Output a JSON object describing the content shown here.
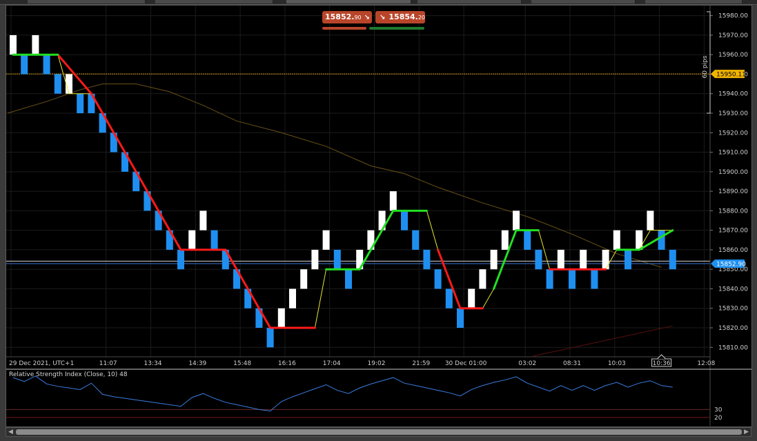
{
  "quotes": {
    "sell_price_main": "15852.",
    "sell_price_sub": "90",
    "buy_price_main": "15854.",
    "buy_price_sub": "20",
    "sell_arrow": "↘",
    "buy_arrow": "↘",
    "sell_color": "#b8452a",
    "buy_color": "#b8452a"
  },
  "price_chart": {
    "type": "renko",
    "y_ticks": [
      "15980.00",
      "15970.00",
      "15960.00",
      "15950.00",
      "15940.00",
      "15930.00",
      "15920.00",
      "15910.00",
      "15900.00",
      "15890.00",
      "15880.00",
      "15870.00",
      "15860.00",
      "15850.00",
      "15840.00",
      "15830.00",
      "15820.00",
      "15810.00"
    ],
    "y_tick_values": [
      15980,
      15970,
      15960,
      15950,
      15940,
      15930,
      15920,
      15910,
      15900,
      15890,
      15880,
      15870,
      15860,
      15850,
      15840,
      15830,
      15820,
      15810
    ],
    "ylim": [
      15805.5,
      15982
    ],
    "x_labels": [
      "29 Dec 2021, UTC+1",
      "11:07",
      "13:34",
      "14:39",
      "15:48",
      "16:16",
      "17:04",
      "19:02",
      "21:59",
      "30 Dec 01:00",
      "03:02",
      "08:31",
      "10:03",
      "10:36",
      "12:08"
    ],
    "x_label_slots": [
      0,
      8.5,
      12.5,
      16.5,
      20.5,
      24.5,
      28.5,
      32.5,
      36.5,
      40.5,
      46,
      50,
      54,
      58,
      62
    ],
    "brick_size": 10,
    "bricks": [
      {
        "t": 0,
        "o": 15960,
        "c": 15970
      },
      {
        "t": 1,
        "o": 15960,
        "c": 15950
      },
      {
        "t": 2,
        "o": 15960,
        "c": 15970
      },
      {
        "t": 3,
        "o": 15960,
        "c": 15950
      },
      {
        "t": 4,
        "o": 15950,
        "c": 15940
      },
      {
        "t": 5,
        "o": 15940,
        "c": 15950
      },
      {
        "t": 6,
        "o": 15940,
        "c": 15930
      },
      {
        "t": 7,
        "o": 15940,
        "c": 15930
      },
      {
        "t": 8,
        "o": 15930,
        "c": 15920
      },
      {
        "t": 9,
        "o": 15920,
        "c": 15910
      },
      {
        "t": 10,
        "o": 15910,
        "c": 15900
      },
      {
        "t": 11,
        "o": 15900,
        "c": 15890
      },
      {
        "t": 12,
        "o": 15890,
        "c": 15880
      },
      {
        "t": 13,
        "o": 15880,
        "c": 15870
      },
      {
        "t": 14,
        "o": 15870,
        "c": 15860
      },
      {
        "t": 15,
        "o": 15860,
        "c": 15850
      },
      {
        "t": 16,
        "o": 15860,
        "c": 15870
      },
      {
        "t": 17,
        "o": 15870,
        "c": 15880
      },
      {
        "t": 18,
        "o": 15870,
        "c": 15860
      },
      {
        "t": 19,
        "o": 15860,
        "c": 15850
      },
      {
        "t": 20,
        "o": 15850,
        "c": 15840
      },
      {
        "t": 21,
        "o": 15840,
        "c": 15830
      },
      {
        "t": 22,
        "o": 15830,
        "c": 15820
      },
      {
        "t": 23,
        "o": 15820,
        "c": 15810
      },
      {
        "t": 24,
        "o": 15820,
        "c": 15830
      },
      {
        "t": 25,
        "o": 15830,
        "c": 15840
      },
      {
        "t": 26,
        "o": 15840,
        "c": 15850
      },
      {
        "t": 27,
        "o": 15850,
        "c": 15860
      },
      {
        "t": 28,
        "o": 15860,
        "c": 15870
      },
      {
        "t": 29,
        "o": 15860,
        "c": 15850
      },
      {
        "t": 30,
        "o": 15850,
        "c": 15840
      },
      {
        "t": 31,
        "o": 15850,
        "c": 15860
      },
      {
        "t": 32,
        "o": 15860,
        "c": 15870
      },
      {
        "t": 33,
        "o": 15870,
        "c": 15880
      },
      {
        "t": 34,
        "o": 15880,
        "c": 15890
      },
      {
        "t": 35,
        "o": 15880,
        "c": 15870
      },
      {
        "t": 36,
        "o": 15870,
        "c": 15860
      },
      {
        "t": 37,
        "o": 15860,
        "c": 15850
      },
      {
        "t": 38,
        "o": 15850,
        "c": 15840
      },
      {
        "t": 39,
        "o": 15840,
        "c": 15830
      },
      {
        "t": 40,
        "o": 15830,
        "c": 15820
      },
      {
        "t": 41,
        "o": 15830,
        "c": 15840
      },
      {
        "t": 42,
        "o": 15840,
        "c": 15850
      },
      {
        "t": 43,
        "o": 15850,
        "c": 15860
      },
      {
        "t": 44,
        "o": 15860,
        "c": 15870
      },
      {
        "t": 45,
        "o": 15870,
        "c": 15880
      },
      {
        "t": 46,
        "o": 15870,
        "c": 15860
      },
      {
        "t": 47,
        "o": 15860,
        "c": 15850
      },
      {
        "t": 48,
        "o": 15850,
        "c": 15840
      },
      {
        "t": 49,
        "o": 15850,
        "c": 15860
      },
      {
        "t": 50,
        "o": 15850,
        "c": 15840
      },
      {
        "t": 51,
        "o": 15850,
        "c": 15860
      },
      {
        "t": 52,
        "o": 15850,
        "c": 15840
      },
      {
        "t": 53,
        "o": 15850,
        "c": 15860
      },
      {
        "t": 54,
        "o": 15860,
        "c": 15870
      },
      {
        "t": 55,
        "o": 15860,
        "c": 15850
      },
      {
        "t": 56,
        "o": 15860,
        "c": 15870
      },
      {
        "t": 57,
        "o": 15870,
        "c": 15880
      },
      {
        "t": 58,
        "o": 15870,
        "c": 15860
      },
      {
        "t": 59,
        "o": 15860,
        "c": 15850
      }
    ],
    "trend_line": [
      {
        "x": 0,
        "y": 15960
      },
      {
        "x": 4,
        "y": 15960
      },
      {
        "x": 5,
        "y": 15940
      },
      {
        "x": 7,
        "y": 15940
      },
      {
        "x": 15,
        "y": 15860
      },
      {
        "x": 19,
        "y": 15860
      },
      {
        "x": 23,
        "y": 15820
      },
      {
        "x": 27,
        "y": 15820
      },
      {
        "x": 28,
        "y": 15850
      },
      {
        "x": 31,
        "y": 15850
      },
      {
        "x": 34,
        "y": 15880
      },
      {
        "x": 37,
        "y": 15880
      },
      {
        "x": 38,
        "y": 15860
      },
      {
        "x": 40,
        "y": 15830
      },
      {
        "x": 42,
        "y": 15830
      },
      {
        "x": 43,
        "y": 15840
      },
      {
        "x": 45,
        "y": 15870
      },
      {
        "x": 47,
        "y": 15870
      },
      {
        "x": 48,
        "y": 15850
      },
      {
        "x": 53,
        "y": 15850
      },
      {
        "x": 54,
        "y": 15860
      },
      {
        "x": 56,
        "y": 15860
      },
      {
        "x": 57,
        "y": 15870
      },
      {
        "x": 59,
        "y": 15870
      }
    ],
    "trend_red_segments": [
      [
        4,
        7
      ],
      [
        7,
        15
      ],
      [
        15,
        19
      ],
      [
        19,
        23
      ],
      [
        23,
        27
      ],
      [
        38,
        40
      ],
      [
        40,
        42
      ],
      [
        48,
        53
      ]
    ],
    "trend_green_segments": [
      [
        0,
        4
      ],
      [
        28,
        31
      ],
      [
        31,
        34
      ],
      [
        34,
        37
      ],
      [
        43,
        45
      ],
      [
        45,
        47
      ],
      [
        54,
        56
      ],
      [
        56,
        59
      ]
    ],
    "moving_average": [
      {
        "x": -0.5,
        "y": 15930
      },
      {
        "x": 3,
        "y": 15936
      },
      {
        "x": 6,
        "y": 15942
      },
      {
        "x": 8,
        "y": 15945
      },
      {
        "x": 11,
        "y": 15945
      },
      {
        "x": 14,
        "y": 15941
      },
      {
        "x": 17,
        "y": 15934
      },
      {
        "x": 20,
        "y": 15926
      },
      {
        "x": 24,
        "y": 15920
      },
      {
        "x": 28,
        "y": 15913
      },
      {
        "x": 32,
        "y": 15903
      },
      {
        "x": 35,
        "y": 15899
      },
      {
        "x": 38,
        "y": 15892
      },
      {
        "x": 42,
        "y": 15884
      },
      {
        "x": 46,
        "y": 15877
      },
      {
        "x": 50,
        "y": 15868
      },
      {
        "x": 54,
        "y": 15858
      },
      {
        "x": 58,
        "y": 15851
      }
    ],
    "red_trend_ray": {
      "from": {
        "x": 46.5,
        "y": 15805.5
      },
      "to": {
        "x": 59,
        "y": 15821
      }
    },
    "bid_line": 15852.9,
    "ask_line": 15854.2,
    "bid_label": "15852.90",
    "target_line": 15950.11,
    "target_label": "15950.11",
    "range_label": "60 pips",
    "range": [
      15930,
      15982
    ],
    "colors": {
      "up_brick": "#ffffff",
      "down_brick": "#1e8ff0",
      "trend_up": "#22e022",
      "trend_down": "#ff1a1a",
      "trend_flip": "#e8e830",
      "moving_average": "#6b5316",
      "target_line": "#d49b1a",
      "bid_label_bg": "#1e8ff0",
      "target_label_bg": "#f0b400"
    }
  },
  "rsi": {
    "title": "Relative Strength Index (Close, 10) 48",
    "levels": [
      "30",
      "20"
    ],
    "level_values": [
      30,
      20
    ],
    "ylim": [
      13,
      77
    ],
    "line_color": "#3a7de0",
    "points": [
      {
        "x": 0,
        "y": 70
      },
      {
        "x": 1,
        "y": 65
      },
      {
        "x": 2,
        "y": 72
      },
      {
        "x": 3,
        "y": 62
      },
      {
        "x": 4,
        "y": 59
      },
      {
        "x": 5,
        "y": 57
      },
      {
        "x": 6,
        "y": 55
      },
      {
        "x": 7,
        "y": 63
      },
      {
        "x": 8,
        "y": 49
      },
      {
        "x": 9,
        "y": 46
      },
      {
        "x": 10,
        "y": 44
      },
      {
        "x": 11,
        "y": 42
      },
      {
        "x": 12,
        "y": 40
      },
      {
        "x": 13,
        "y": 38
      },
      {
        "x": 14,
        "y": 36
      },
      {
        "x": 15,
        "y": 34
      },
      {
        "x": 16,
        "y": 45
      },
      {
        "x": 17,
        "y": 50
      },
      {
        "x": 18,
        "y": 44
      },
      {
        "x": 19,
        "y": 39
      },
      {
        "x": 20,
        "y": 36
      },
      {
        "x": 21,
        "y": 33
      },
      {
        "x": 22,
        "y": 30
      },
      {
        "x": 23,
        "y": 28
      },
      {
        "x": 24,
        "y": 40
      },
      {
        "x": 25,
        "y": 46
      },
      {
        "x": 26,
        "y": 51
      },
      {
        "x": 27,
        "y": 56
      },
      {
        "x": 28,
        "y": 61
      },
      {
        "x": 29,
        "y": 54
      },
      {
        "x": 30,
        "y": 50
      },
      {
        "x": 31,
        "y": 57
      },
      {
        "x": 32,
        "y": 62
      },
      {
        "x": 33,
        "y": 66
      },
      {
        "x": 34,
        "y": 70
      },
      {
        "x": 35,
        "y": 63
      },
      {
        "x": 36,
        "y": 60
      },
      {
        "x": 37,
        "y": 57
      },
      {
        "x": 38,
        "y": 54
      },
      {
        "x": 39,
        "y": 51
      },
      {
        "x": 40,
        "y": 47
      },
      {
        "x": 41,
        "y": 55
      },
      {
        "x": 42,
        "y": 60
      },
      {
        "x": 43,
        "y": 64
      },
      {
        "x": 44,
        "y": 67
      },
      {
        "x": 45,
        "y": 71
      },
      {
        "x": 46,
        "y": 63
      },
      {
        "x": 47,
        "y": 58
      },
      {
        "x": 48,
        "y": 53
      },
      {
        "x": 49,
        "y": 60
      },
      {
        "x": 50,
        "y": 54
      },
      {
        "x": 51,
        "y": 60
      },
      {
        "x": 52,
        "y": 54
      },
      {
        "x": 53,
        "y": 60
      },
      {
        "x": 54,
        "y": 64
      },
      {
        "x": 55,
        "y": 58
      },
      {
        "x": 56,
        "y": 63
      },
      {
        "x": 57,
        "y": 66
      },
      {
        "x": 58,
        "y": 60
      },
      {
        "x": 59,
        "y": 58
      }
    ]
  }
}
